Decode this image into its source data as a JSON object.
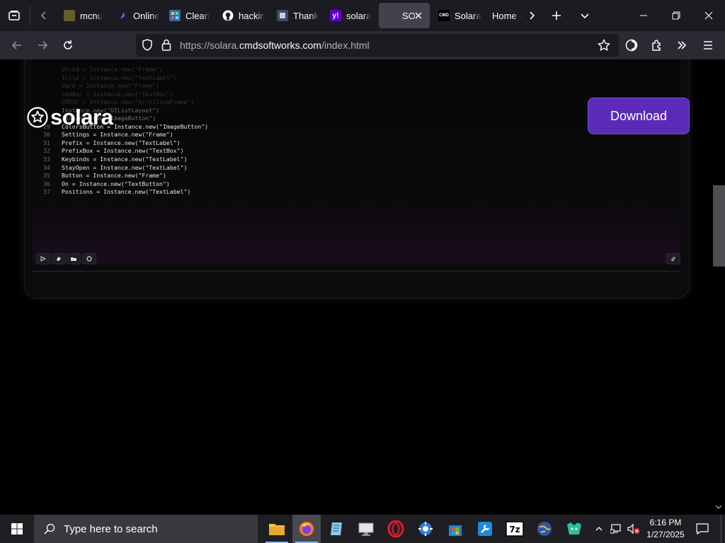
{
  "browser": {
    "tabs": [
      {
        "label": "mcnu",
        "icon": "folder-favicon",
        "active": false
      },
      {
        "label": "Online",
        "icon": "online-favicon",
        "active": false
      },
      {
        "label": "Clean",
        "icon": "clean-favicon",
        "active": false
      },
      {
        "label": "hackin",
        "icon": "github-favicon",
        "active": false
      },
      {
        "label": "Thank",
        "icon": "thank-favicon",
        "active": false
      },
      {
        "label": "solara",
        "icon": "yahoo-favicon",
        "active": false
      },
      {
        "label": "SOI",
        "icon": "blank-favicon",
        "active": true
      },
      {
        "label": "Solara",
        "icon": "cmd-favicon",
        "active": false
      },
      {
        "label": "Home -",
        "icon": "none",
        "active": false
      }
    ],
    "url": {
      "prefix": "https://solara.",
      "domain": "cmdsoftworks.com",
      "path": "/index.html"
    }
  },
  "page": {
    "brand": "solara",
    "download_label": "Download",
    "code_lines": [
      {
        "n": "",
        "text": "Utlod = Instance.new(\"Frame\")"
      },
      {
        "n": "",
        "text": "Title = Instance.new(\"TextLabel\")"
      },
      {
        "n": "",
        "text": "Dark = Instance.new(\"Frame\")"
      },
      {
        "n": "",
        "text": "CmdBar = Instance.new(\"TextBox\")"
      },
      {
        "n": "",
        "text": "CMDSF = Instance.new(\"ScrollingFrame\")"
      },
      {
        "n": "",
        "text": "Instance.new(\"UIListLayout\")"
      },
      {
        "n": "",
        "text": "Instance.new(\"ImageButton\")"
      },
      {
        "n": "29",
        "text": "ColorsButton = Instance.new(\"ImageButton\")"
      },
      {
        "n": "30",
        "text": "Settings = Instance.new(\"Frame\")"
      },
      {
        "n": "31",
        "text": "Prefix = Instance.new(\"TextLabel\")"
      },
      {
        "n": "32",
        "text": "PrefixBox = Instance.new(\"TextBox\")"
      },
      {
        "n": "33",
        "text": "Keybinds = Instance.new(\"TextLabel\")"
      },
      {
        "n": "34",
        "text": "StayOpen = Instance.new(\"TextLabel\")"
      },
      {
        "n": "35",
        "text": "Button = Instance.new(\"Frame\")"
      },
      {
        "n": "36",
        "text": "On = Instance.new(\"TextButton\")"
      },
      {
        "n": "37",
        "text": "Positions = Instance.new(\"TextLabel\")"
      }
    ]
  },
  "taskbar": {
    "search_placeholder": "Type here to search",
    "time": "6:16 PM",
    "date": "1/27/2025",
    "apps": [
      "file-explorer",
      "firefox",
      "notepad",
      "remote-desktop",
      "opera",
      "settings-app",
      "store",
      "toolbox",
      "7zip",
      "globe-app",
      "game-app"
    ]
  },
  "colors": {
    "accent": "#5b2bb8",
    "tab_bg": "#1c1b22",
    "nav_bg": "#2b2a33",
    "active_tab": "#42414d"
  }
}
